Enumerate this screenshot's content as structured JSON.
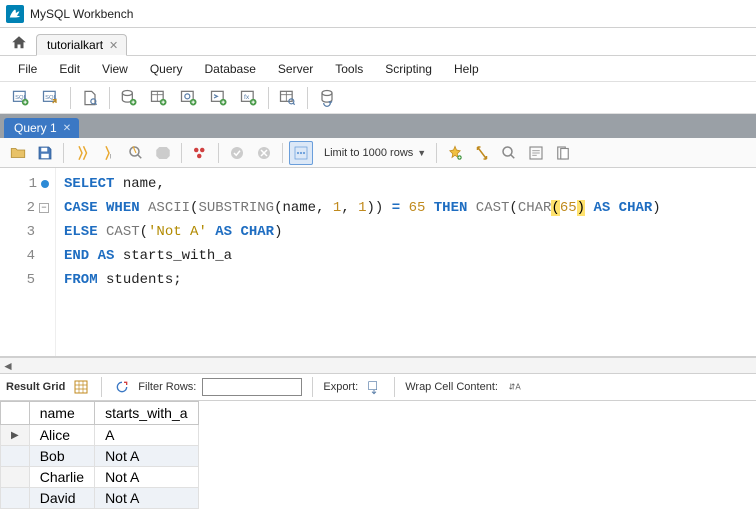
{
  "window": {
    "title": "MySQL Workbench"
  },
  "file_tab": {
    "label": "tutorialkart"
  },
  "menu": [
    "File",
    "Edit",
    "View",
    "Query",
    "Database",
    "Server",
    "Tools",
    "Scripting",
    "Help"
  ],
  "query_tab": {
    "label": "Query 1"
  },
  "editor_toolbar": {
    "limit_label": "Limit to 1000 rows"
  },
  "code": {
    "lines": [
      {
        "n": 1,
        "bp": true,
        "tokens": [
          [
            "kw",
            "SELECT"
          ],
          [
            "id",
            " name"
          ],
          [
            "id",
            ","
          ]
        ]
      },
      {
        "n": 2,
        "fold": true,
        "tokens": [
          [
            "kw",
            "CASE"
          ],
          [
            "id",
            " "
          ],
          [
            "kw",
            "WHEN"
          ],
          [
            "id",
            " "
          ],
          [
            "fn",
            "ASCII"
          ],
          [
            "id",
            "("
          ],
          [
            "fn",
            "SUBSTRING"
          ],
          [
            "id",
            "(name"
          ],
          [
            "id",
            ", "
          ],
          [
            "num",
            "1"
          ],
          [
            "id",
            ", "
          ],
          [
            "num",
            "1"
          ],
          [
            "id",
            "))"
          ],
          [
            "id",
            " "
          ],
          [
            "kw",
            "="
          ],
          [
            "id",
            " "
          ],
          [
            "num",
            "65"
          ],
          [
            "id",
            " "
          ],
          [
            "kw",
            "THEN"
          ],
          [
            "id",
            " "
          ],
          [
            "fn",
            "CAST"
          ],
          [
            "id",
            "("
          ],
          [
            "fn",
            "CHAR"
          ],
          [
            "hl",
            "("
          ],
          [
            "num",
            "65"
          ],
          [
            "hl",
            ")"
          ],
          [
            "id",
            " "
          ],
          [
            "kw",
            "AS"
          ],
          [
            "id",
            " "
          ],
          [
            "kw",
            "CHAR"
          ],
          [
            "id",
            ")"
          ]
        ]
      },
      {
        "n": 3,
        "tokens": [
          [
            "kw",
            "ELSE"
          ],
          [
            "id",
            " "
          ],
          [
            "fn",
            "CAST"
          ],
          [
            "id",
            "("
          ],
          [
            "str",
            "'Not A'"
          ],
          [
            "id",
            " "
          ],
          [
            "kw",
            "AS"
          ],
          [
            "id",
            " "
          ],
          [
            "kw",
            "CHAR"
          ],
          [
            "id",
            ")"
          ]
        ]
      },
      {
        "n": 4,
        "tokens": [
          [
            "kw",
            "END"
          ],
          [
            "id",
            " "
          ],
          [
            "kw",
            "AS"
          ],
          [
            "id",
            " starts_with_a"
          ]
        ]
      },
      {
        "n": 5,
        "tokens": [
          [
            "kw",
            "FROM"
          ],
          [
            "id",
            " students"
          ],
          [
            "id",
            ";"
          ]
        ]
      }
    ]
  },
  "result_bar": {
    "grid_label": "Result Grid",
    "filter_label": "Filter Rows:",
    "filter_value": "",
    "export_label": "Export:",
    "wrap_label": "Wrap Cell Content:"
  },
  "result": {
    "columns": [
      "name",
      "starts_with_a"
    ],
    "rows": [
      {
        "cells": [
          "Alice",
          "A"
        ],
        "current": true
      },
      {
        "cells": [
          "Bob",
          "Not A"
        ]
      },
      {
        "cells": [
          "Charlie",
          "Not A"
        ]
      },
      {
        "cells": [
          "David",
          "Not A"
        ]
      }
    ]
  }
}
